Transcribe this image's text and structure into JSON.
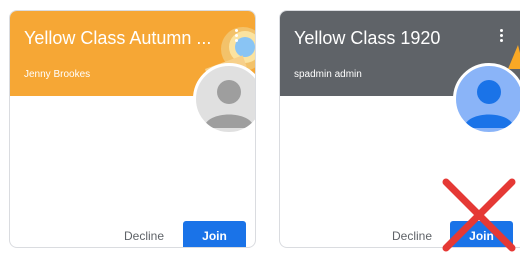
{
  "cards": [
    {
      "title": "Yellow Class Autumn ...",
      "teacher": "Jenny Brookes",
      "banner_color": "#f6a735",
      "decline_label": "Decline",
      "join_label": "Join"
    },
    {
      "title": "Yellow Class 1920",
      "teacher": "spadmin admin",
      "banner_color": "#5f6368",
      "decline_label": "Decline",
      "join_label": "Join"
    }
  ],
  "colors": {
    "join_button": "#1a73e8",
    "avatar_default_gray": "#9e9e9e",
    "avatar_default_blue": "#8ab4f8",
    "cross_mark": "#e53935"
  },
  "icons": [
    "more-vert-icon",
    "person-avatar-icon",
    "red-cross-mark"
  ]
}
